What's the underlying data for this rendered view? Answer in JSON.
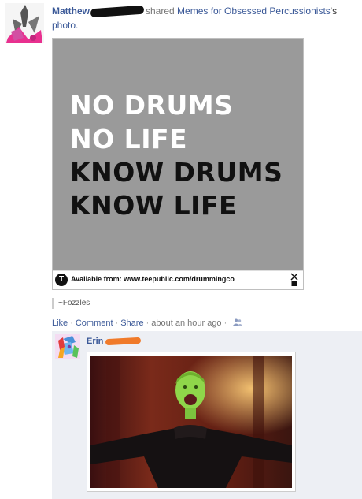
{
  "post": {
    "poster_name": "Matthew",
    "shared_text": "shared",
    "page_name": "Memes for Obsessed Percussionists",
    "possessive": "'s",
    "object": "photo."
  },
  "photo": {
    "lines": [
      "NO DRUMS",
      "NO LIFE",
      "KNOW DRUMS",
      "KNOW LIFE"
    ],
    "available_text": "Available from: www.teepublic.com/drummingco",
    "tee_glyph": "T",
    "background": "#9a9a9a"
  },
  "caption": "~Fozzles",
  "actions": {
    "like": "Like",
    "comment": "Comment",
    "share": "Share",
    "separator": "·",
    "time": "about an hour ago",
    "people_icon": "people-icon"
  },
  "comment": {
    "name": "Erin"
  },
  "colors": {
    "link": "#3b5998",
    "comment_bg": "#edeff4",
    "scribble_black": "#111111",
    "scribble_orange": "#f07a2a"
  }
}
